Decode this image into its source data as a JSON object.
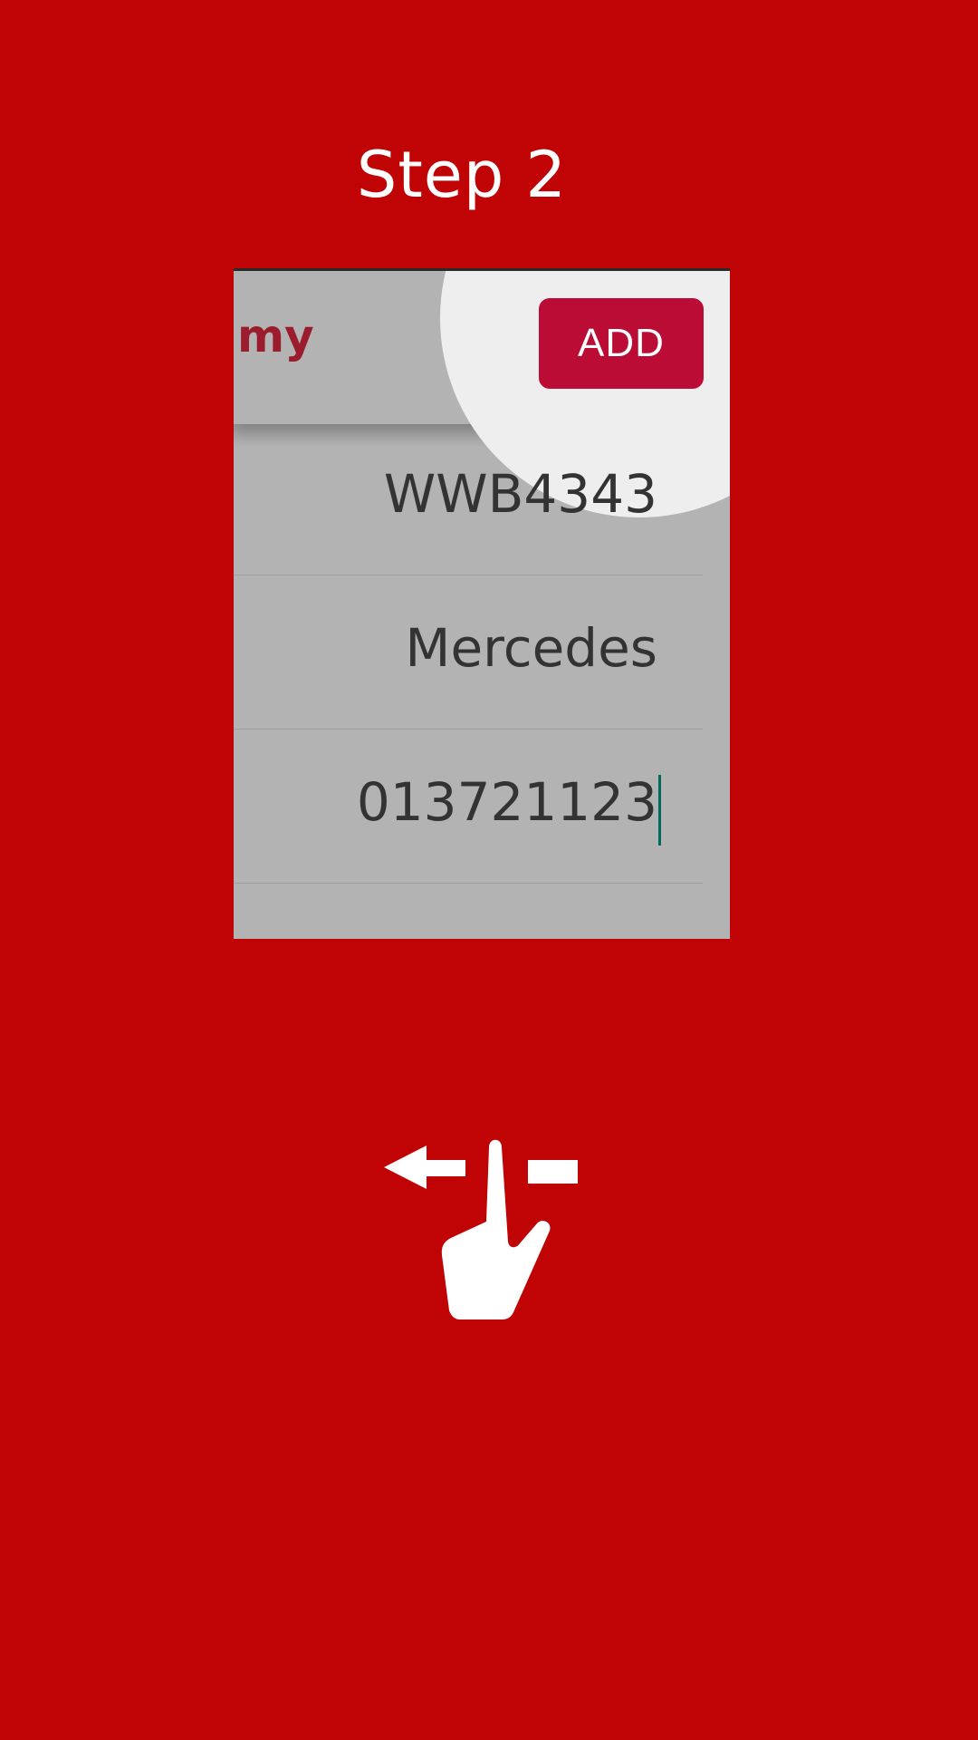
{
  "title": "Step 2",
  "preview": {
    "header_text": "my",
    "add_label": "ADD",
    "fields": [
      {
        "value": "WWB4343"
      },
      {
        "value": "Mercedes"
      },
      {
        "value": "013721123"
      }
    ]
  },
  "gesture": {
    "icon": "swipe-left-icon"
  },
  "colors": {
    "background": "#c00305",
    "accent": "#bb0c35",
    "overlay": "#b3b3b3",
    "spotlight": "#eeeeee"
  }
}
